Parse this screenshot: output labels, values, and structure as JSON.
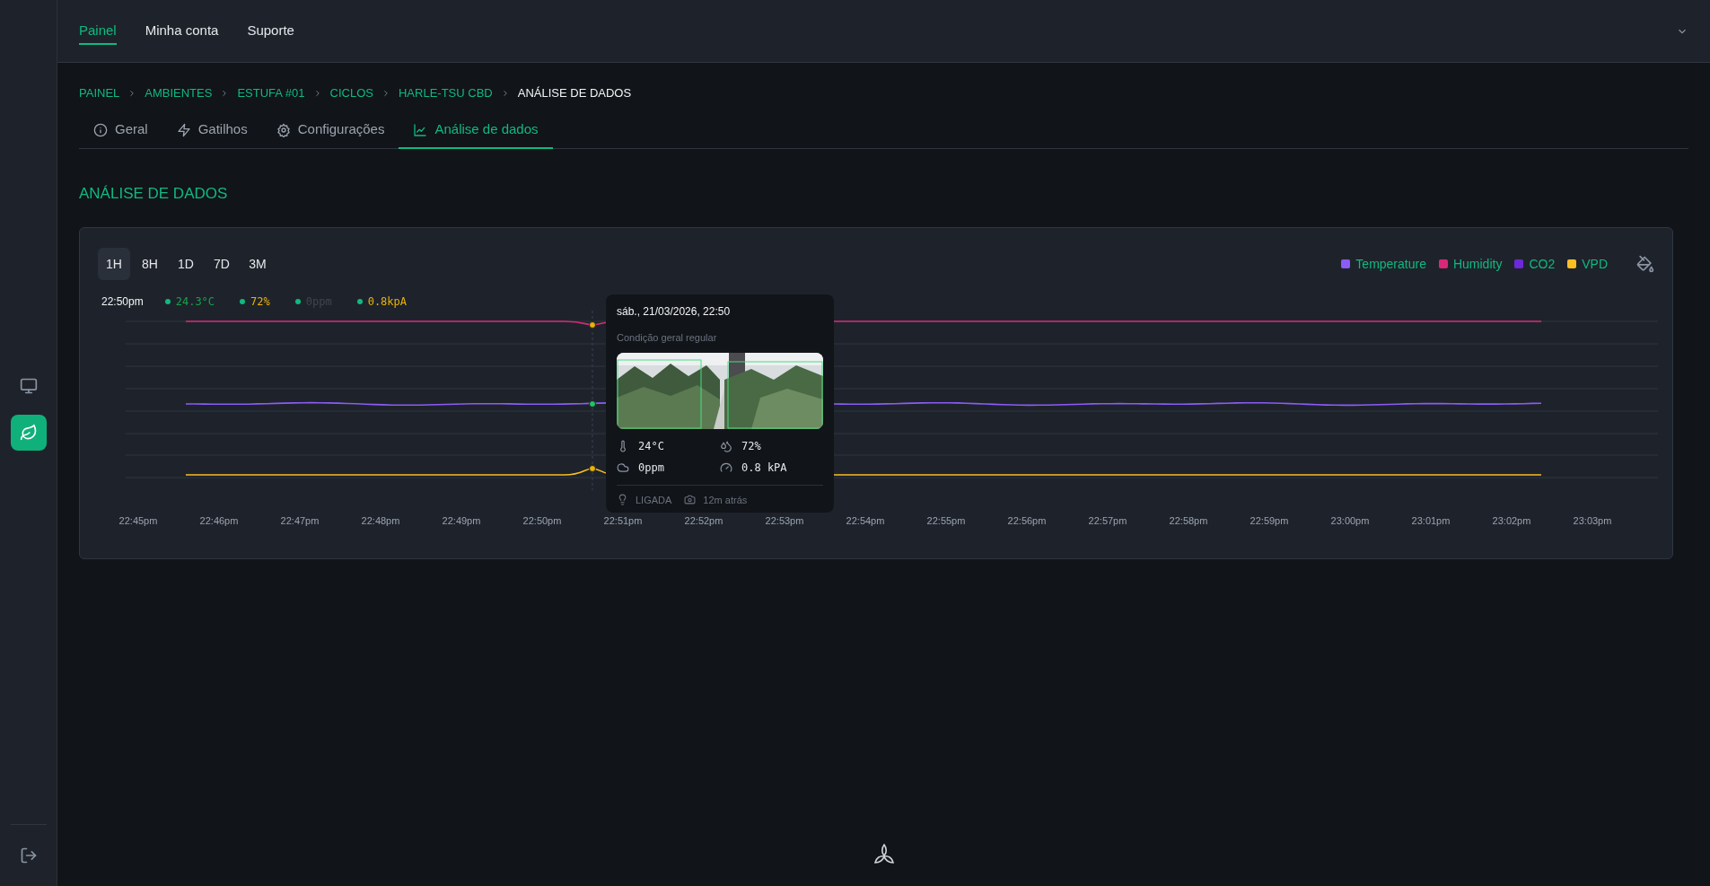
{
  "nav": [
    {
      "label": "Painel",
      "selected": true
    },
    {
      "label": "Minha conta",
      "selected": false
    },
    {
      "label": "Suporte",
      "selected": false
    }
  ],
  "sidebar": [
    {
      "kind": "monitor",
      "selected": false
    },
    {
      "kind": "leaf",
      "selected": true
    }
  ],
  "breadcrumb": [
    {
      "label": "PAINEL",
      "selected": false
    },
    {
      "label": "AMBIENTES",
      "selected": false
    },
    {
      "label": "ESTUFA #01",
      "selected": false
    },
    {
      "label": "CICLOS",
      "selected": false
    },
    {
      "label": "HARLE-TSU CBD",
      "selected": false
    },
    {
      "label": "ANÁLISE DE DADOS",
      "selected": true
    }
  ],
  "tabs": [
    {
      "label": "Geral",
      "kind": "info",
      "selected": false
    },
    {
      "label": "Gatilhos",
      "kind": "bolt",
      "selected": false
    },
    {
      "label": "Configurações",
      "kind": "gear",
      "selected": false
    },
    {
      "label": "Análise de dados",
      "kind": "chart",
      "selected": true
    }
  ],
  "section_title": "ANÁLISE DE DADOS",
  "ranges": [
    {
      "label": "1H",
      "selected": true
    },
    {
      "label": "8H",
      "selected": false
    },
    {
      "label": "1D",
      "selected": false
    },
    {
      "label": "7D",
      "selected": false
    },
    {
      "label": "3M",
      "selected": false
    }
  ],
  "legend": [
    {
      "label": "Temperature",
      "color": "#8b5cf6"
    },
    {
      "label": "Humidity",
      "color": "#db2777"
    },
    {
      "label": "CO2",
      "color": "#6d28d9"
    },
    {
      "label": "VPD",
      "color": "#fbbf24"
    }
  ],
  "readout": {
    "time": "22:50pm",
    "values": [
      {
        "text": "24.3°C",
        "color": "#16a34a"
      },
      {
        "text": "72%",
        "color": "#eab308"
      },
      {
        "text": "0ppm",
        "color": "#3f4650"
      },
      {
        "text": "0.8kpA",
        "color": "#eab308"
      }
    ]
  },
  "x_labels": [
    "22:45pm",
    "22:46pm",
    "22:47pm",
    "22:48pm",
    "22:49pm",
    "22:50pm",
    "22:51pm",
    "22:52pm",
    "22:53pm",
    "22:54pm",
    "22:55pm",
    "22:56pm",
    "22:57pm",
    "22:58pm",
    "22:59pm",
    "23:00pm",
    "23:01pm",
    "23:02pm",
    "23:03pm"
  ],
  "tooltip": {
    "title": "sáb., 21/03/2026, 22:50",
    "subtitle": "Condição geral regular",
    "metrics": [
      {
        "kind": "temperature",
        "text": "24°C"
      },
      {
        "kind": "humidity",
        "text": "72%"
      },
      {
        "kind": "co2",
        "text": "0ppm"
      },
      {
        "kind": "pressure",
        "text": "0.8 kPA"
      }
    ],
    "footer": [
      {
        "kind": "light",
        "text": "LIGADA"
      },
      {
        "kind": "camera",
        "text": "12m atrás"
      }
    ]
  }
}
